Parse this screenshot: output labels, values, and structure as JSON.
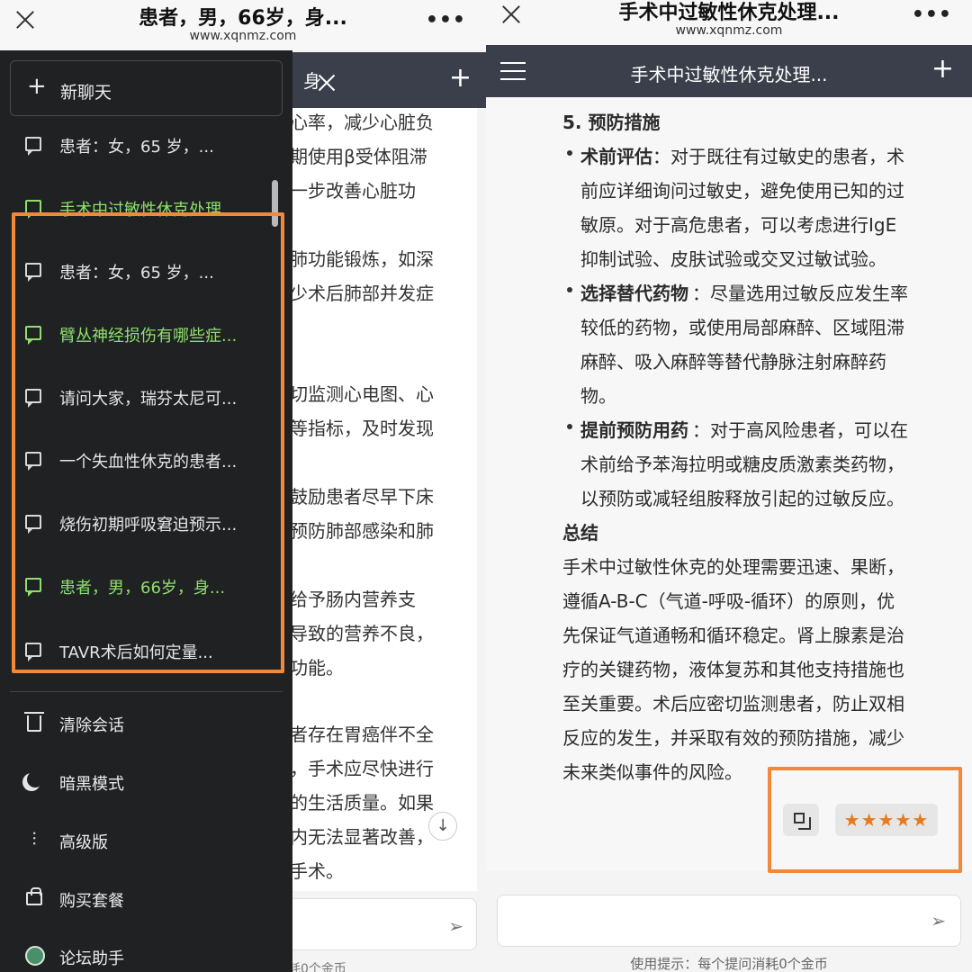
{
  "left_screen": {
    "browser": {
      "title": "患者，男，66岁，身...",
      "url": "www.xqnmz.com",
      "more": "•••"
    },
    "chat_header": {
      "title": "身"
    },
    "background_lines": [
      "心率，减少心脏负",
      "期使用β受体阻滞",
      "一步改善心脏功",
      "肺功能锻炼，如深",
      "少术后肺部并发症",
      "切监测心电图、心",
      "等指标，及时发现",
      "鼓励患者尽早下床",
      "预防肺部感染和肺",
      "给予肠内营养支",
      "导致的营养不良，",
      "功能。",
      "者存在胃癌伴不全",
      "，手术应尽快进行",
      "的生活质量。如果",
      "内无法显著改善，",
      "手术。"
    ],
    "input_hint": "耗0个金币",
    "drawer": {
      "new_chat_label": "新聊天",
      "conversations": [
        {
          "label": "患者：女，65 岁，...",
          "active": false
        },
        {
          "label": "手术中过敏性休克处理...",
          "active": true
        },
        {
          "label": "患者：女，65 岁，...",
          "active": false
        },
        {
          "label": "臂丛神经损伤有哪些症...",
          "active": true
        },
        {
          "label": "请问大家，瑞芬太尼可...",
          "active": false
        },
        {
          "label": "一个失血性休克的患者...",
          "active": false
        },
        {
          "label": "烧伤初期呼吸窘迫预示...",
          "active": false
        },
        {
          "label": "患者，男，66岁，身...",
          "active": true
        },
        {
          "label": "TAVR术后如何定量...",
          "active": false
        }
      ],
      "menu": [
        {
          "label": "清除会话",
          "icon": "trash-icon"
        },
        {
          "label": "暗黑模式",
          "icon": "moon-icon"
        },
        {
          "label": "高级版",
          "icon": "sliders-icon"
        },
        {
          "label": "购买套餐",
          "icon": "bag-icon"
        },
        {
          "label": "论坛助手",
          "icon": "forum-globe-icon"
        }
      ]
    }
  },
  "right_screen": {
    "browser": {
      "title": "手术中过敏性休克处理...",
      "url": "www.xqnmz.com",
      "more": "•••"
    },
    "chat_header": {
      "title": "手术中过敏性休克处理..."
    },
    "answer": {
      "section_heading": "5. 预防措施",
      "bullets": [
        {
          "title": "术前评估",
          "lines": [
            "：对于既往有过敏史的患者，术",
            "前应详细询问过敏史，避免使用已知的过",
            "敏原。对于高危患者，可以考虑进行IgE",
            "抑制试验、皮肤试验或交叉过敏试验。"
          ]
        },
        {
          "title": "选择替代药物",
          "lines": [
            "：尽量选用过敏反应发生率",
            "较低的药物，或使用局部麻醉、区域阻滞",
            "麻醉、吸入麻醉等替代静脉注射麻醉药",
            "物。"
          ]
        },
        {
          "title": "提前预防用药",
          "lines": [
            "：对于高风险患者，可以在",
            "术前给予苯海拉明或糖皮质激素类药物，",
            "以预防或减轻组胺释放引起的过敏反应。"
          ]
        }
      ],
      "summary_heading": "总结",
      "summary_lines": [
        "手术中过敏性休克的处理需要迅速、果断，",
        "遵循A-B-C（气道-呼吸-循环）的原则，优",
        "先保证气道通畅和循环稳定。肾上腺素是治",
        "疗的关键药物，液体复苏和其他支持措施也",
        "至关重要。术后应密切监测患者，防止双相",
        "反应的发生，并采取有效的预防措施，减少",
        "未来类似事件的风险。"
      ]
    },
    "rating": "★★★★★",
    "input_hint": "使用提示：每个提问消耗0个金币"
  },
  "colors": {
    "drawer_bg": "#202123",
    "header_bg": "#3a3f4b",
    "active_green": "#8ee06b",
    "highlight_orange": "#f0893a",
    "star_orange": "#e67a1f"
  }
}
